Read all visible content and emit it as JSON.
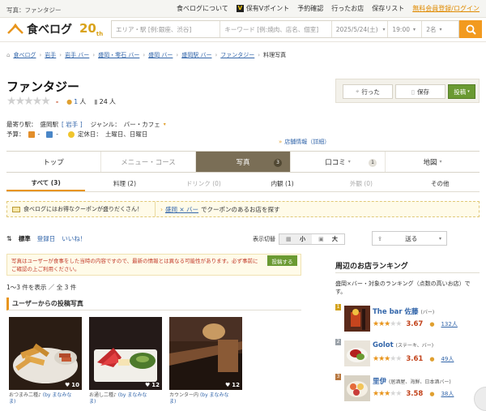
{
  "topbar": {
    "breadcrumb": "写真：ファンタジー",
    "links": [
      "食べログについて",
      "保有Vポイント",
      "予約確認",
      "行ったお店",
      "保存リスト"
    ],
    "signup": "無料会員登録/ログイン"
  },
  "header": {
    "logo_text": "食べログ",
    "anniversary": "20",
    "anniversary_suffix": "th",
    "area_placeholder": "エリア・駅 [例:銀座、渋谷]",
    "keyword_placeholder": "キーワード [例:焼肉、店名、個室]",
    "date": "2025/5/24(土)",
    "time": "19:00",
    "people": "2名"
  },
  "breadcrumb": [
    "食べログ",
    "岩手",
    "岩手 バー",
    "盛岡・零石 バー",
    "盛岡 バー",
    "盛岡駅 バー",
    "ファンタジー",
    "料理写真"
  ],
  "shop": {
    "name": "ファンタジー",
    "rating_dash": "-",
    "reviews": "1",
    "reviews_unit": "人",
    "saved": "24",
    "saved_unit": "人",
    "nearest_label": "最寄り駅：",
    "nearest": "盛岡駅",
    "pref": "[ 岩手 ]",
    "genre_label": "ジャンル：",
    "genre": "バー・カフェ",
    "budget_label": "予算：",
    "holiday_label": "定休日：",
    "holiday": "土曜日、日曜日",
    "store_info": "店舗情報（詳細）"
  },
  "actions": {
    "went": "行った",
    "save": "保存",
    "post": "投稿"
  },
  "main_tabs": [
    {
      "label": "トップ",
      "count": ""
    },
    {
      "label": "メニュー・コース",
      "count": ""
    },
    {
      "label": "写真",
      "count": "3"
    },
    {
      "label": "口コミ",
      "count": "1"
    },
    {
      "label": "地図",
      "count": ""
    }
  ],
  "sub_tabs": [
    "すべて (3)",
    "料理 (2)",
    "ドリンク (0)",
    "内観 (1)",
    "外観 (0)",
    "その他"
  ],
  "coupon": {
    "left": "食べログにはお得なクーポンが盛りだくさん！",
    "right_link": "盛岡 × バー",
    "right_text": "でクーポンのあるお店を探す"
  },
  "sort": {
    "standard": "標準",
    "date": "登録日",
    "like": "いいね！"
  },
  "display": {
    "label": "表示切替",
    "small": "小",
    "large": "大"
  },
  "notice": "写真はユーザーが食事をした当時の内容ですので、最新の情報とは異なる可能性があります。必ず事前にご確認の上ご利用ください。",
  "post_photo": "投稿する",
  "count_text": "1～3 件を表示 ／ 全 3 件",
  "section_title": "ユーザーからの投稿写真",
  "photos": [
    {
      "likes": "10",
      "caption": "おつまみ二種♪",
      "by": "(by まなみな",
      "by2": "ま)"
    },
    {
      "likes": "12",
      "caption": "お通し二種♪",
      "by": "(by まなみな",
      "by2": "ま)"
    },
    {
      "likes": "12",
      "caption": "カウンター内",
      "by": "(by まなみな",
      "by2": "ま)"
    }
  ],
  "share": "送る",
  "ranking": {
    "title": "周辺のお店ランキング",
    "desc": "盛岡×バー・対象のランキング（点数の高いお店）です。",
    "items": [
      {
        "rank": "1",
        "name": "The bar 佐藤",
        "genre": "(バー)",
        "score": "3.67",
        "reviews": "132人",
        "rank_color": "#d3a21d"
      },
      {
        "rank": "2",
        "name": "Golot",
        "genre": "(ステーキ、バー)",
        "score": "3.61",
        "reviews": "49人",
        "rank_color": "#9aa1a8"
      },
      {
        "rank": "3",
        "name": "里伊",
        "genre": "(居酒屋、海鮮、日本酒バー)",
        "score": "3.58",
        "reviews": "38人",
        "rank_color": "#b7773f"
      }
    ]
  }
}
